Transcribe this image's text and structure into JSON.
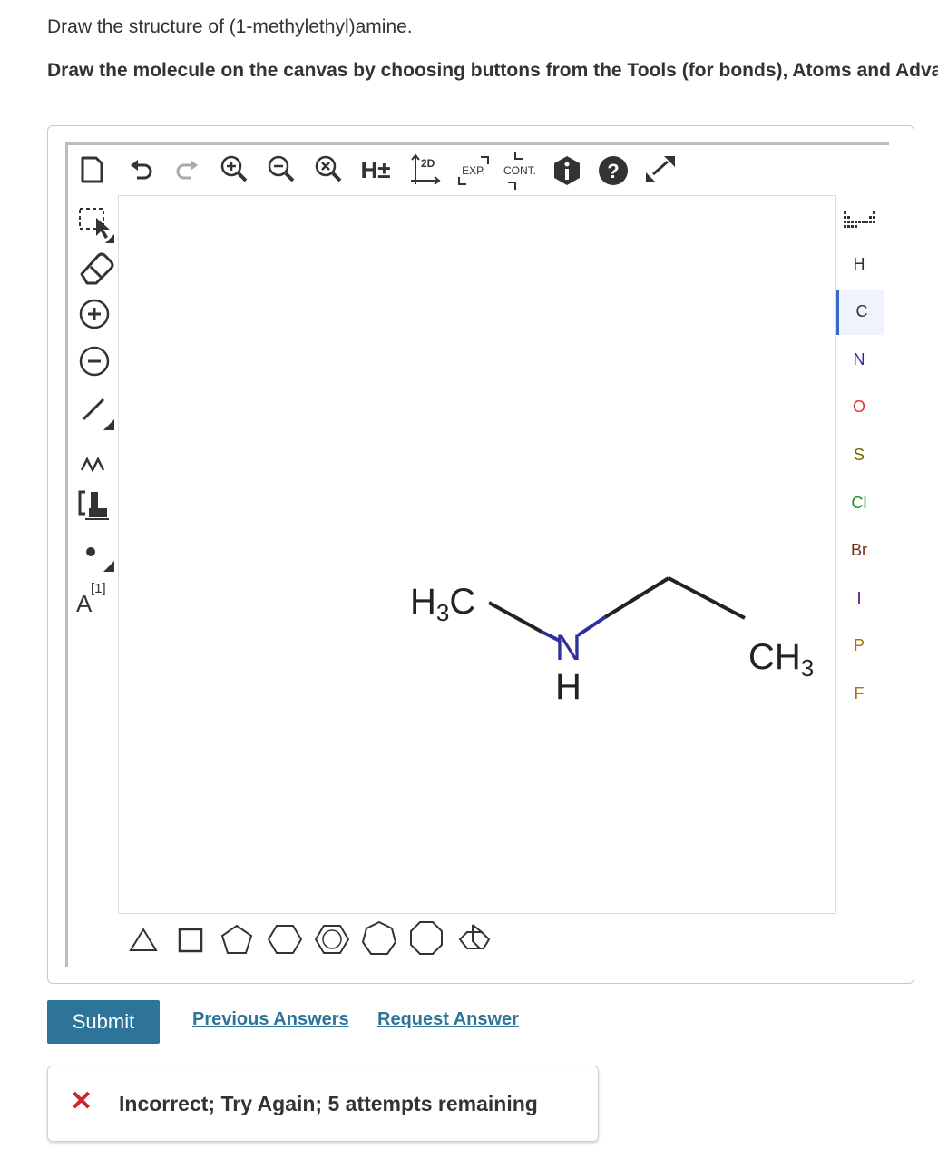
{
  "question": {
    "prompt": "Draw the structure of (1-methylethyl)amine.",
    "instructions": "Draw the molecule on the canvas by choosing buttons from the Tools (for bonds), Atoms and Advanced Template toolbars. The single bond is active by default."
  },
  "top_toolbar": {
    "hydrogen_label": "H±",
    "layout_label": "2D",
    "expand_label": "EXP.",
    "contract_label": "CONT."
  },
  "left_toolbar": {
    "charge_label": "A",
    "charge_superscript": "[1]"
  },
  "atoms": [
    "H",
    "C",
    "N",
    "O",
    "S",
    "Cl",
    "Br",
    "I",
    "P",
    "F"
  ],
  "atom_colors": {
    "H": "#333333",
    "C": "#333333",
    "N": "#30309b",
    "O": "#e03030",
    "S": "#6b6b00",
    "Cl": "#1e8f1e",
    "Br": "#7a2a1a",
    "I": "#5a0a7a",
    "P": "#b07000",
    "F": "#b07000"
  },
  "selected_atom": "C",
  "molecule": {
    "left_group": "H3C",
    "center_atom": "N",
    "center_h": "H",
    "right_group": "CH3",
    "nitrogen_color": "#30309b"
  },
  "templates": [
    "triangle",
    "square",
    "pentagon",
    "hexagon",
    "benzene",
    "heptagon",
    "octagon",
    "bicyclic"
  ],
  "actions": {
    "submit": "Submit",
    "previous": "Previous Answers",
    "request": "Request Answer"
  },
  "feedback": {
    "icon": "x-icon",
    "message": "Incorrect; Try Again; 5 attempts remaining"
  }
}
